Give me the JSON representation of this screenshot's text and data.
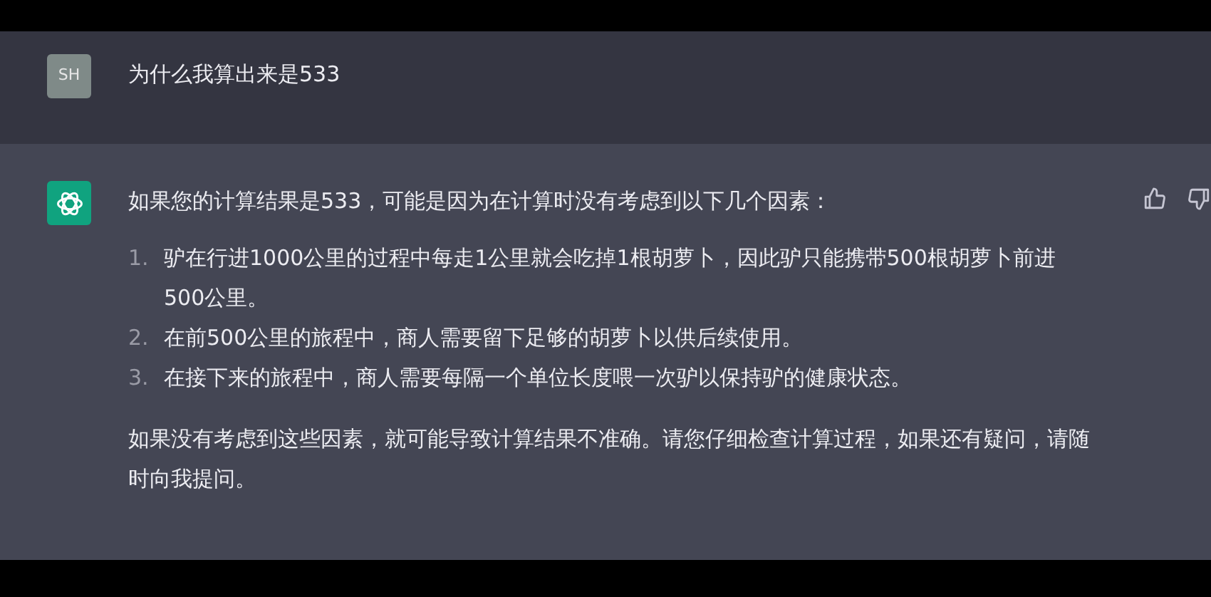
{
  "user_message": {
    "avatar": "SH",
    "text": "为什么我算出来是533"
  },
  "assistant_message": {
    "intro": "如果您的计算结果是533，可能是因为在计算时没有考虑到以下几个因素：",
    "list": [
      {
        "number": "1.",
        "text": "驴在行进1000公里的过程中每走1公里就会吃掉1根胡萝卜，因此驴只能携带500根胡萝卜前进500公里。"
      },
      {
        "number": "2.",
        "text": "在前500公里的旅程中，商人需要留下足够的胡萝卜以供后续使用。"
      },
      {
        "number": "3.",
        "text": "在接下来的旅程中，商人需要每隔一个单位长度喂一次驴以保持驴的健康状态。"
      }
    ],
    "conclusion": "如果没有考虑到这些因素，就可能导致计算结果不准确。请您仔细检查计算过程，如果还有疑问，请随时向我提问。"
  }
}
